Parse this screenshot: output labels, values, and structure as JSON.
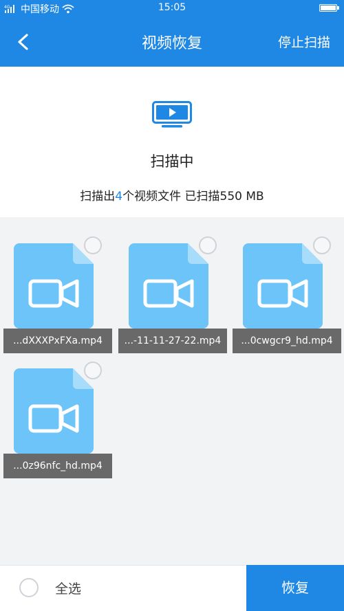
{
  "status_bar": {
    "carrier": "中国移动",
    "time": "15:05",
    "signal_label": "4G"
  },
  "title_bar": {
    "title": "视频恢复",
    "stop_label": "停止扫描"
  },
  "header": {
    "status": "扫描中",
    "summary_prefix": "扫描出",
    "count": "4",
    "summary_suffix": "个视频文件 已扫描550 MB"
  },
  "files": [
    {
      "name": "...dXXXPxFXa.mp4"
    },
    {
      "name": "...-11-11-27-22.mp4"
    },
    {
      "name": "...0cwgcr9_hd.mp4"
    },
    {
      "name": "...0z96nfc_hd.mp4"
    }
  ],
  "bottom_bar": {
    "select_all_label": "全选",
    "recover_label": "恢复"
  },
  "colors": {
    "accent": "#1f88e5",
    "file_icon": "#6cc4f8"
  }
}
